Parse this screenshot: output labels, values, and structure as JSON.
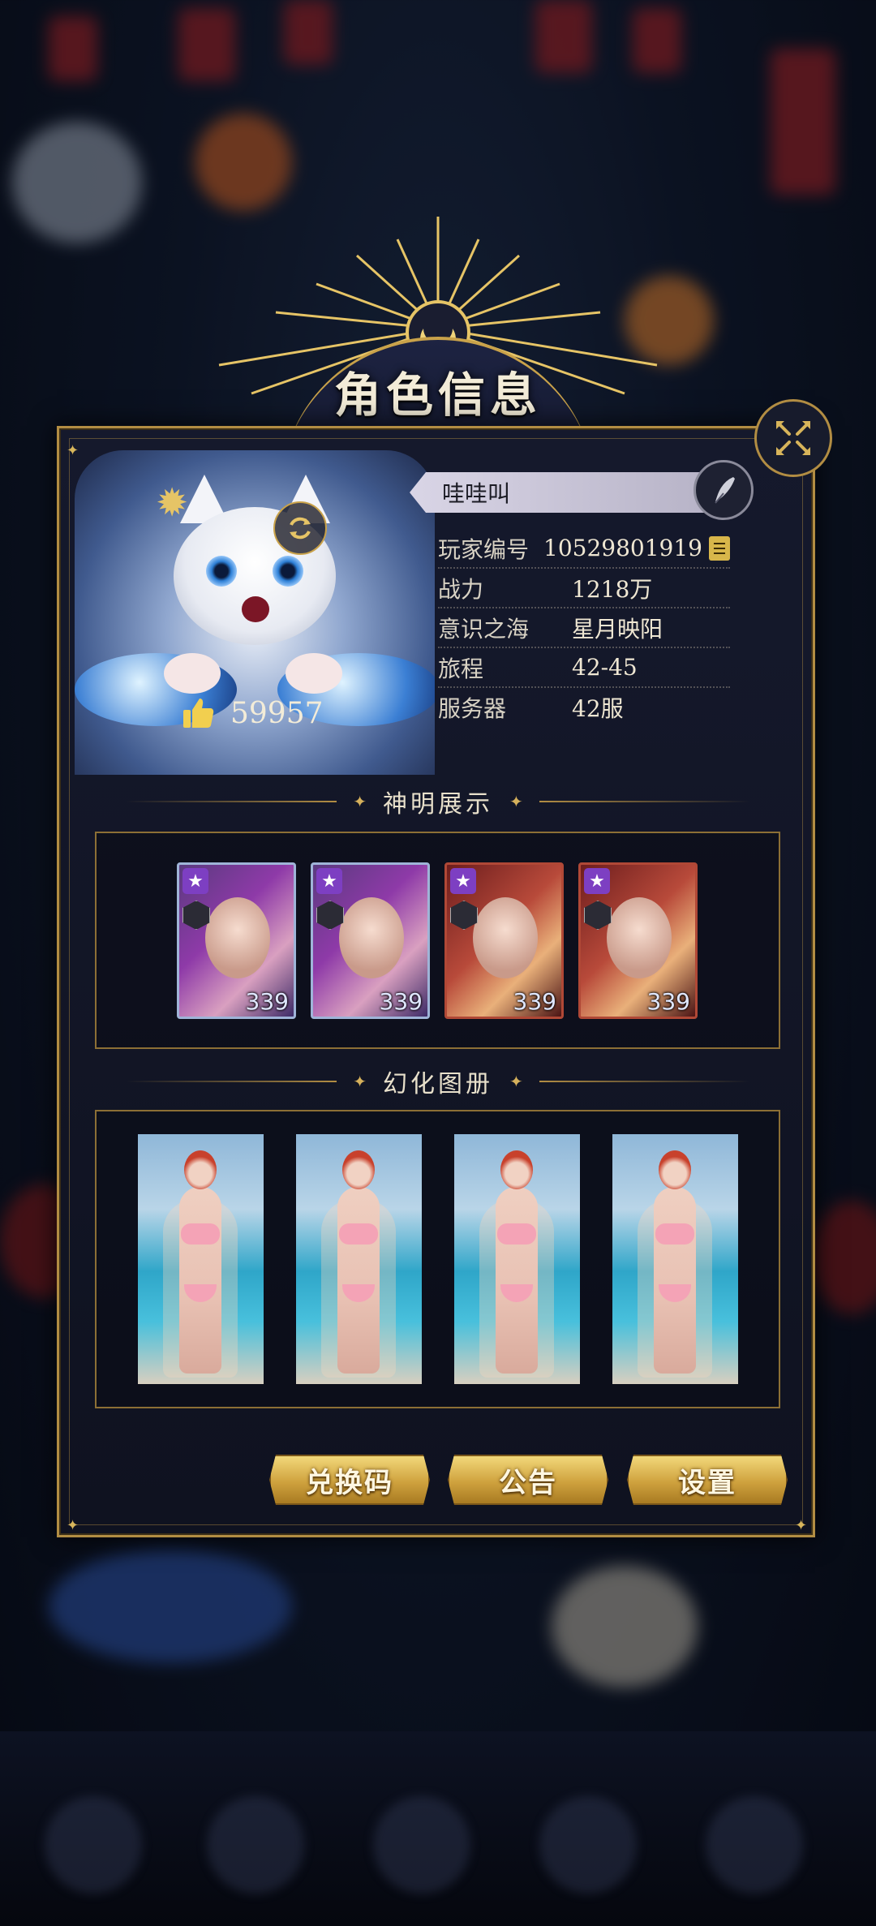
{
  "title": "角色信息",
  "profile": {
    "name": "哇哇叫",
    "likes": "59957",
    "info": [
      {
        "label": "玩家编号",
        "value": "10529801919"
      },
      {
        "label": "战力",
        "value": "1218万"
      },
      {
        "label": "意识之海",
        "value": "星月映阳"
      },
      {
        "label": "旅程",
        "value": "42-45"
      },
      {
        "label": "服务器",
        "value": "42服"
      }
    ]
  },
  "sections": {
    "gods_title": "神明展示",
    "gallery_title": "幻化图册"
  },
  "gods": [
    {
      "level": "339",
      "frame": "blue",
      "star": "★"
    },
    {
      "level": "339",
      "frame": "blue",
      "star": "★"
    },
    {
      "level": "339",
      "frame": "red",
      "star": "★"
    },
    {
      "level": "339",
      "frame": "red",
      "star": "★"
    }
  ],
  "buttons": {
    "redeem": "兑换码",
    "notice": "公告",
    "settings": "设置"
  },
  "colors": {
    "gold": "#b28d43",
    "panel": "#15192c",
    "button_gold": "#cfa23e",
    "star_purple": "#7d3fc2"
  }
}
